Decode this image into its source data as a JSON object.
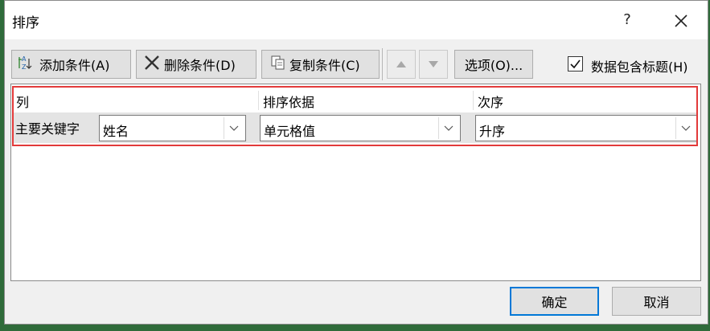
{
  "dialog": {
    "title": "排序",
    "help_label": "?",
    "close_icon": "close-icon"
  },
  "toolbar": {
    "add_label": "添加条件(A)",
    "delete_label": "删除条件(D)",
    "copy_label": "复制条件(C)",
    "move_up_icon": "triangle-up-icon",
    "move_down_icon": "triangle-down-icon",
    "options_label": "选项(O)...",
    "has_headers_label": "数据包含标题(H)",
    "has_headers_checked": true
  },
  "table": {
    "headers": {
      "column": "列",
      "sort_on": "排序依据",
      "order": "次序"
    },
    "rows": [
      {
        "label": "主要关键字",
        "column": "姓名",
        "sort_on": "单元格值",
        "order": "升序"
      }
    ]
  },
  "footer": {
    "ok_label": "确定",
    "cancel_label": "取消"
  },
  "colors": {
    "highlight_frame": "#e23a3a",
    "focus_border": "#0078d7"
  }
}
